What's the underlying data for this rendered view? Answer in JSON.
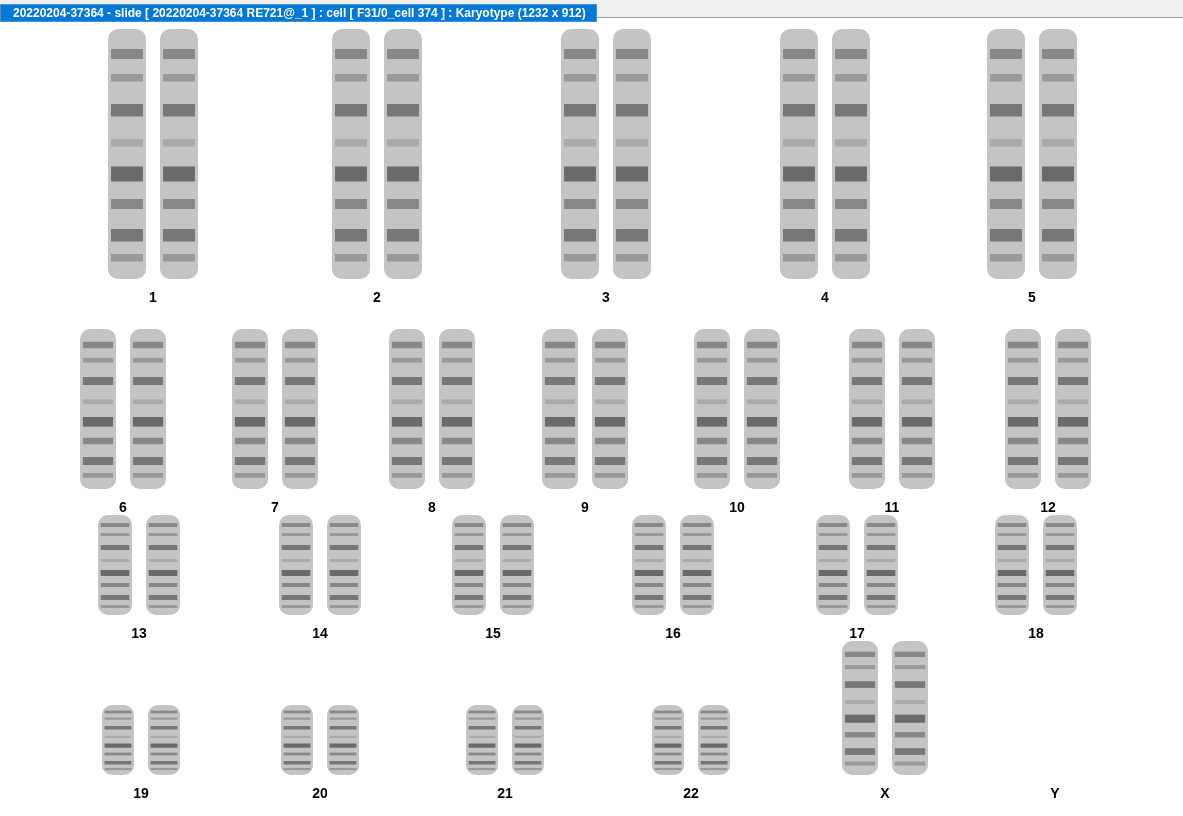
{
  "window": {
    "title": "20220204-37364 - slide [ 20220204-37364 RE721@_1 ] : cell [ F31/0_cell 374 ] : Karyotype  (1232 x 912)"
  },
  "rows": [
    {
      "groups": [
        {
          "label": "1",
          "kind": "pair"
        },
        {
          "label": "2",
          "kind": "pair"
        },
        {
          "label": "3",
          "kind": "pair"
        },
        {
          "label": "4",
          "kind": "pair"
        },
        {
          "label": "5",
          "kind": "pair"
        }
      ]
    },
    {
      "groups": [
        {
          "label": "6",
          "kind": "pair"
        },
        {
          "label": "7",
          "kind": "pair"
        },
        {
          "label": "8",
          "kind": "pair"
        },
        {
          "label": "9",
          "kind": "pair"
        },
        {
          "label": "10",
          "kind": "pair"
        },
        {
          "label": "11",
          "kind": "pair"
        },
        {
          "label": "12",
          "kind": "pair"
        }
      ]
    },
    {
      "groups": [
        {
          "label": "13",
          "kind": "pair"
        },
        {
          "label": "14",
          "kind": "pair"
        },
        {
          "label": "15",
          "kind": "pair"
        },
        {
          "label": "16",
          "kind": "pair"
        },
        {
          "label": "17",
          "kind": "pair"
        },
        {
          "label": "18",
          "kind": "pair"
        }
      ]
    },
    {
      "groups": [
        {
          "label": "19",
          "kind": "pair"
        },
        {
          "label": "20",
          "kind": "pair"
        },
        {
          "label": "21",
          "kind": "pair"
        },
        {
          "label": "22",
          "kind": "pair"
        },
        {
          "label": "X",
          "kind": "pair"
        },
        {
          "label": "Y",
          "kind": "empty"
        }
      ]
    }
  ]
}
